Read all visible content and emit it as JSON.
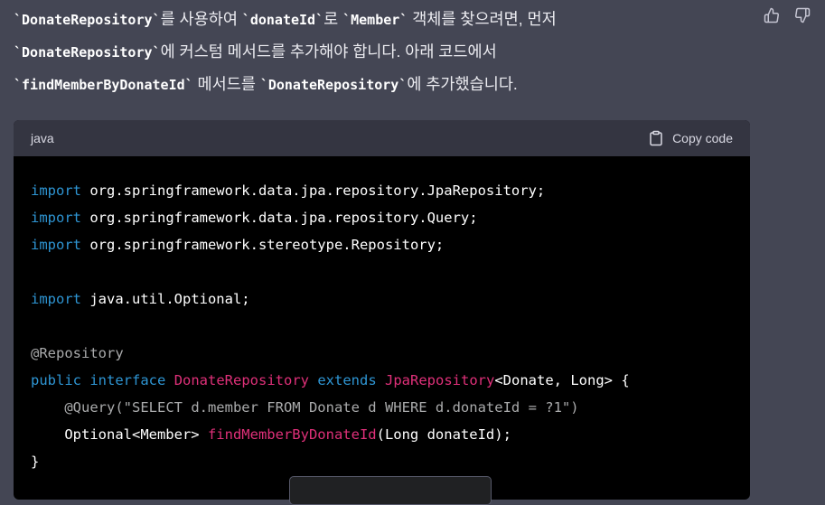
{
  "message": {
    "c1": "`DonateRepository`",
    "t1": "를 사용하여 ",
    "c2": "`donateId`",
    "t2": "로 ",
    "c3": "`Member`",
    "t3": " 객체를 찾으려면, 먼저",
    "c4": "`DonateRepository`",
    "t4": "에 커스텀 메서드를 추가해야 합니다. 아래 코드에서",
    "c5": "`findMemberByDonateId`",
    "t5": " 메서드를 ",
    "c6": "`DonateRepository`",
    "t6": "에 추가했습니다."
  },
  "code_block": {
    "language": "java",
    "copy_label": "Copy code",
    "lines": {
      "imp1_kw": "import",
      "imp1": " org.springframework.data.jpa.repository.JpaRepository;",
      "imp2_kw": "import",
      "imp2": " org.springframework.data.jpa.repository.Query;",
      "imp3_kw": "import",
      "imp3": " org.springframework.stereotype.Repository;",
      "imp4_kw": "import",
      "imp4": " java.util.Optional;",
      "annotation": "@Repository",
      "public_kw": "public",
      "interface_kw": "interface",
      "class_name": "DonateRepository",
      "extends_kw": "extends",
      "super_name": "JpaRepository",
      "generics": "<Donate, Long> {",
      "query_indent": "    ",
      "query_ann": "@Query",
      "query_str": "(\"SELECT d.member FROM Donate d WHERE d.donateId = ?1\")",
      "method_indent": "    ",
      "method_ret": "Optional<Member> ",
      "method_name": "findMemberByDonateId",
      "method_params": "(Long donateId);",
      "close": "}"
    }
  },
  "icons": [
    "thumbs-up-icon",
    "thumbs-down-icon",
    "clipboard-icon"
  ],
  "colors": {
    "background": "#444654",
    "code_bg": "#000000",
    "code_header": "#343541",
    "keyword": "#2e95d3",
    "type_name": "#df3079",
    "annotation": "#a9aaab"
  }
}
